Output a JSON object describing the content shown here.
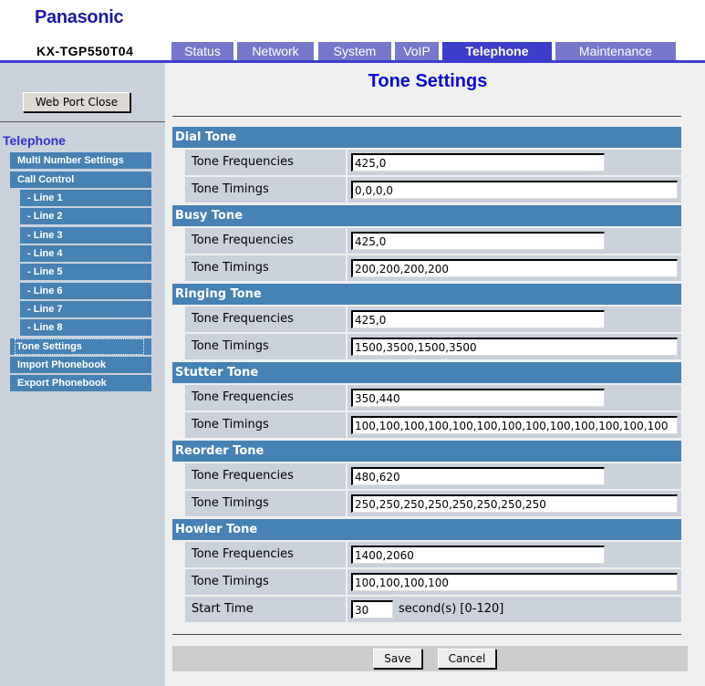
{
  "brand": "Panasonic",
  "model": "KX-TGP550T04",
  "tabs": [
    {
      "label": "Status",
      "active": false
    },
    {
      "label": "Network",
      "active": false
    },
    {
      "label": "System",
      "active": false
    },
    {
      "label": "VoIP",
      "active": false
    },
    {
      "label": "Telephone",
      "active": true
    },
    {
      "label": "Maintenance",
      "active": false
    }
  ],
  "sidebar": {
    "web_port_close": "Web Port Close",
    "title": "Telephone",
    "items": [
      {
        "label": "Multi Number Settings",
        "level": 1
      },
      {
        "label": "Call Control",
        "level": 1
      },
      {
        "label": "- Line 1",
        "level": 2
      },
      {
        "label": "- Line 2",
        "level": 2
      },
      {
        "label": "- Line 3",
        "level": 2
      },
      {
        "label": "- Line 4",
        "level": 2
      },
      {
        "label": "- Line 5",
        "level": 2
      },
      {
        "label": "- Line 6",
        "level": 2
      },
      {
        "label": "- Line 7",
        "level": 2
      },
      {
        "label": "- Line 8",
        "level": 2
      },
      {
        "label": "Tone Settings",
        "level": 1,
        "active": true
      },
      {
        "label": "Import Phonebook",
        "level": 1
      },
      {
        "label": "Export Phonebook",
        "level": 1
      }
    ]
  },
  "main": {
    "title": "Tone Settings",
    "sections": [
      {
        "heading": "Dial Tone",
        "fields": [
          {
            "label": "Tone Frequencies",
            "value": "425,0"
          },
          {
            "label": "Tone Timings",
            "value": "0,0,0,0"
          }
        ]
      },
      {
        "heading": "Busy Tone",
        "fields": [
          {
            "label": "Tone Frequencies",
            "value": "425,0"
          },
          {
            "label": "Tone Timings",
            "value": "200,200,200,200"
          }
        ]
      },
      {
        "heading": "Ringing Tone",
        "fields": [
          {
            "label": "Tone Frequencies",
            "value": "425,0"
          },
          {
            "label": "Tone Timings",
            "value": "1500,3500,1500,3500"
          }
        ]
      },
      {
        "heading": "Stutter Tone",
        "fields": [
          {
            "label": "Tone Frequencies",
            "value": "350,440"
          },
          {
            "label": "Tone Timings",
            "value": "100,100,100,100,100,100,100,100,100,100,100,100,100"
          }
        ]
      },
      {
        "heading": "Reorder Tone",
        "fields": [
          {
            "label": "Tone Frequencies",
            "value": "480,620"
          },
          {
            "label": "Tone Timings",
            "value": "250,250,250,250,250,250,250,250"
          }
        ]
      },
      {
        "heading": "Howler Tone",
        "fields": [
          {
            "label": "Tone Frequencies",
            "value": "1400,2060"
          },
          {
            "label": "Tone Timings",
            "value": "100,100,100,100"
          },
          {
            "label": "Start Time",
            "value": "30",
            "unit": "second(s) [0-120]"
          }
        ]
      }
    ],
    "save_label": "Save",
    "cancel_label": "Cancel"
  }
}
